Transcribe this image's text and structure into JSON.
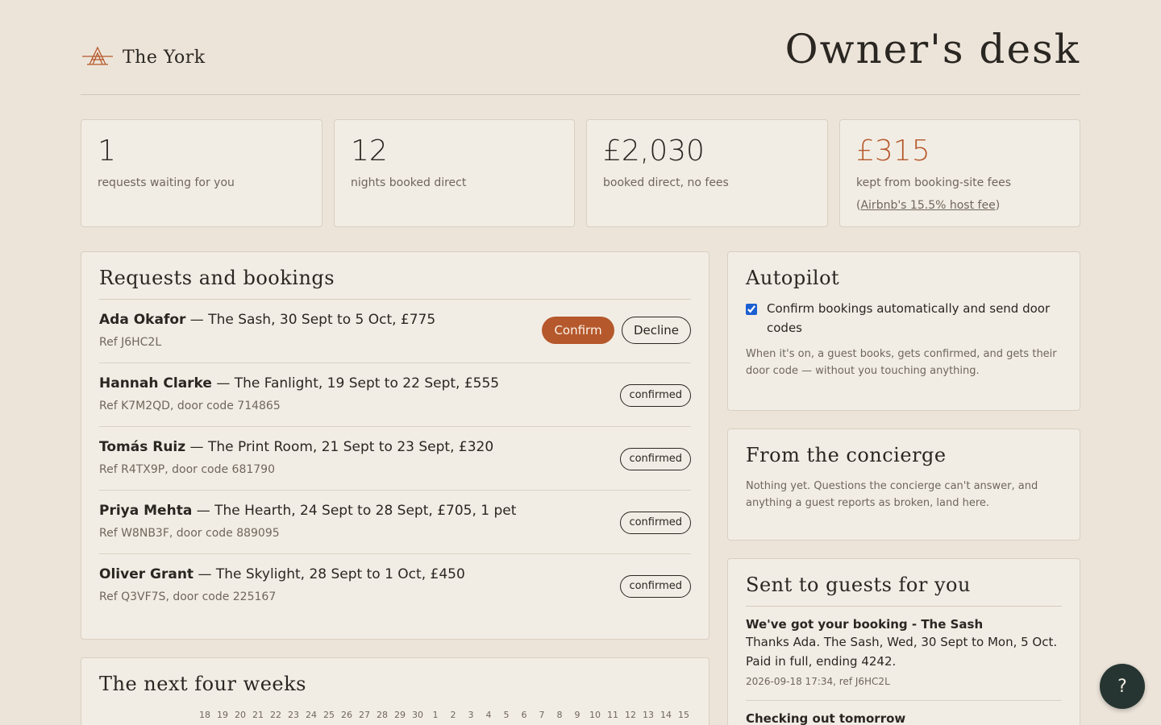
{
  "brand": {
    "name": "The York",
    "icon": "bridge-logo-icon"
  },
  "page_title": "Owner's desk",
  "stats": [
    {
      "value": "1",
      "label": "requests waiting for you"
    },
    {
      "value": "12",
      "label": "nights booked direct"
    },
    {
      "value": "£2,030",
      "label": "booked direct, no fees"
    },
    {
      "value": "£315",
      "label_prefix": "kept from booking-site fees (",
      "link": "Airbnb's 15.5% host fee",
      "label_suffix": ")",
      "color": "#b5582c"
    }
  ],
  "requests": {
    "title": "Requests and bookings",
    "confirm_label": "Confirm",
    "decline_label": "Decline",
    "rows": [
      {
        "guest": "Ada Okafor",
        "detail": " — The Sash, 30 Sept to 5 Oct, £775",
        "ref": "Ref J6HC2L",
        "status": "pending"
      },
      {
        "guest": "Hannah Clarke",
        "detail": " — The Fanlight, 19 Sept to 22 Sept, £555",
        "ref": "Ref K7M2QD, door code 714865",
        "status": "confirmed"
      },
      {
        "guest": "Tomás Ruiz",
        "detail": " — The Print Room, 21 Sept to 23 Sept, £320",
        "ref": "Ref R4TX9P, door code 681790",
        "status": "confirmed"
      },
      {
        "guest": "Priya Mehta",
        "detail": " — The Hearth, 24 Sept to 28 Sept, £705, 1 pet",
        "ref": "Ref W8NB3F, door code 889095",
        "status": "confirmed"
      },
      {
        "guest": "Oliver Grant",
        "detail": " — The Skylight, 28 Sept to 1 Oct, £450",
        "ref": "Ref Q3VF7S, door code 225167",
        "status": "confirmed"
      }
    ]
  },
  "autopilot": {
    "title": "Autopilot",
    "checkbox_label": "Confirm bookings automatically and send door codes",
    "checked": true,
    "description": "When it's on, a guest books, gets confirmed, and gets their door code — without you touching anything."
  },
  "concierge": {
    "title": "From the concierge",
    "description": "Nothing yet. Questions the concierge can't answer, and anything a guest reports as broken, land here."
  },
  "sent": {
    "title": "Sent to guests for you",
    "messages": [
      {
        "title": "We've got your booking - The Sash",
        "body": "Thanks Ada. The Sash, Wed, 30 Sept to Mon, 5 Oct. Paid in full, ending 4242.",
        "meta": "2026-09-18 17:34, ref J6HC2L"
      },
      {
        "title": "Checking out tomorrow",
        "body": "",
        "meta": ""
      }
    ]
  },
  "weeks": {
    "title": "The next four weeks",
    "days": [
      "18",
      "19",
      "20",
      "21",
      "22",
      "23",
      "24",
      "25",
      "26",
      "27",
      "28",
      "29",
      "30",
      "1",
      "2",
      "3",
      "4",
      "5",
      "6",
      "7",
      "8",
      "9",
      "10",
      "11",
      "12",
      "13",
      "14",
      "15"
    ]
  },
  "help": {
    "label": "?"
  },
  "colors": {
    "accent": "#b5582c",
    "background": "#ece4d9",
    "card": "#f2ede4",
    "help_button": "#263531"
  }
}
